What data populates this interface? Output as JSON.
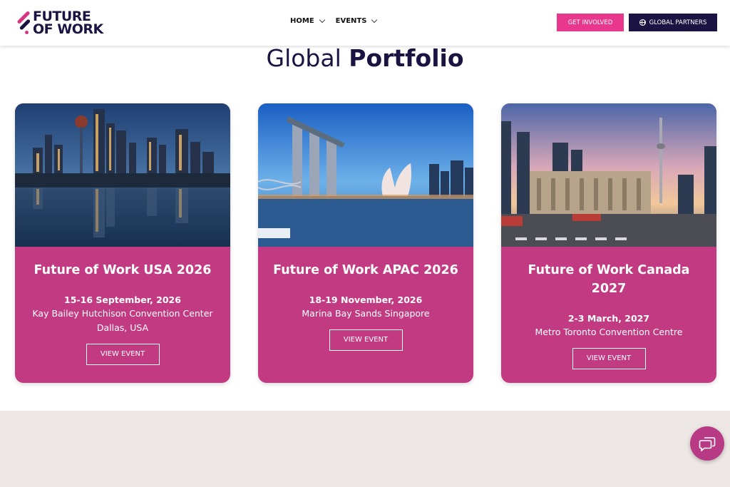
{
  "header": {
    "logo_line1": "FUTURE",
    "logo_line2": "OF WORK",
    "nav": [
      {
        "label": "HOME"
      },
      {
        "label": "EVENTS"
      }
    ],
    "get_involved_label": "GET INVOLVED",
    "global_partners_label": "GLOBAL PARTNERS"
  },
  "section": {
    "title_light": "Global ",
    "title_bold": "Portfolio"
  },
  "cards": [
    {
      "title": "Future of Work USA 2026",
      "date": "15-16 September, 2026",
      "venue_line1": "Kay Bailey Hutchison Convention Center",
      "venue_line2": "Dallas, USA",
      "button": "VIEW EVENT"
    },
    {
      "title": "Future of Work APAC 2026",
      "date": "18-19 November, 2026",
      "venue_line1": "Marina Bay Sands Singapore",
      "venue_line2": "",
      "button": "VIEW EVENT"
    },
    {
      "title": "Future of Work Canada 2027",
      "date": "2-3 March, 2027",
      "venue_line1": "Metro Toronto Convention Centre",
      "venue_line2": "",
      "button": "VIEW EVENT"
    }
  ],
  "colors": {
    "brand_pink": "#e8388d",
    "card_pink": "#c23a81",
    "navy": "#1b1442"
  },
  "icons": [
    "chevron-down-icon",
    "globe-icon",
    "chat-icon"
  ]
}
